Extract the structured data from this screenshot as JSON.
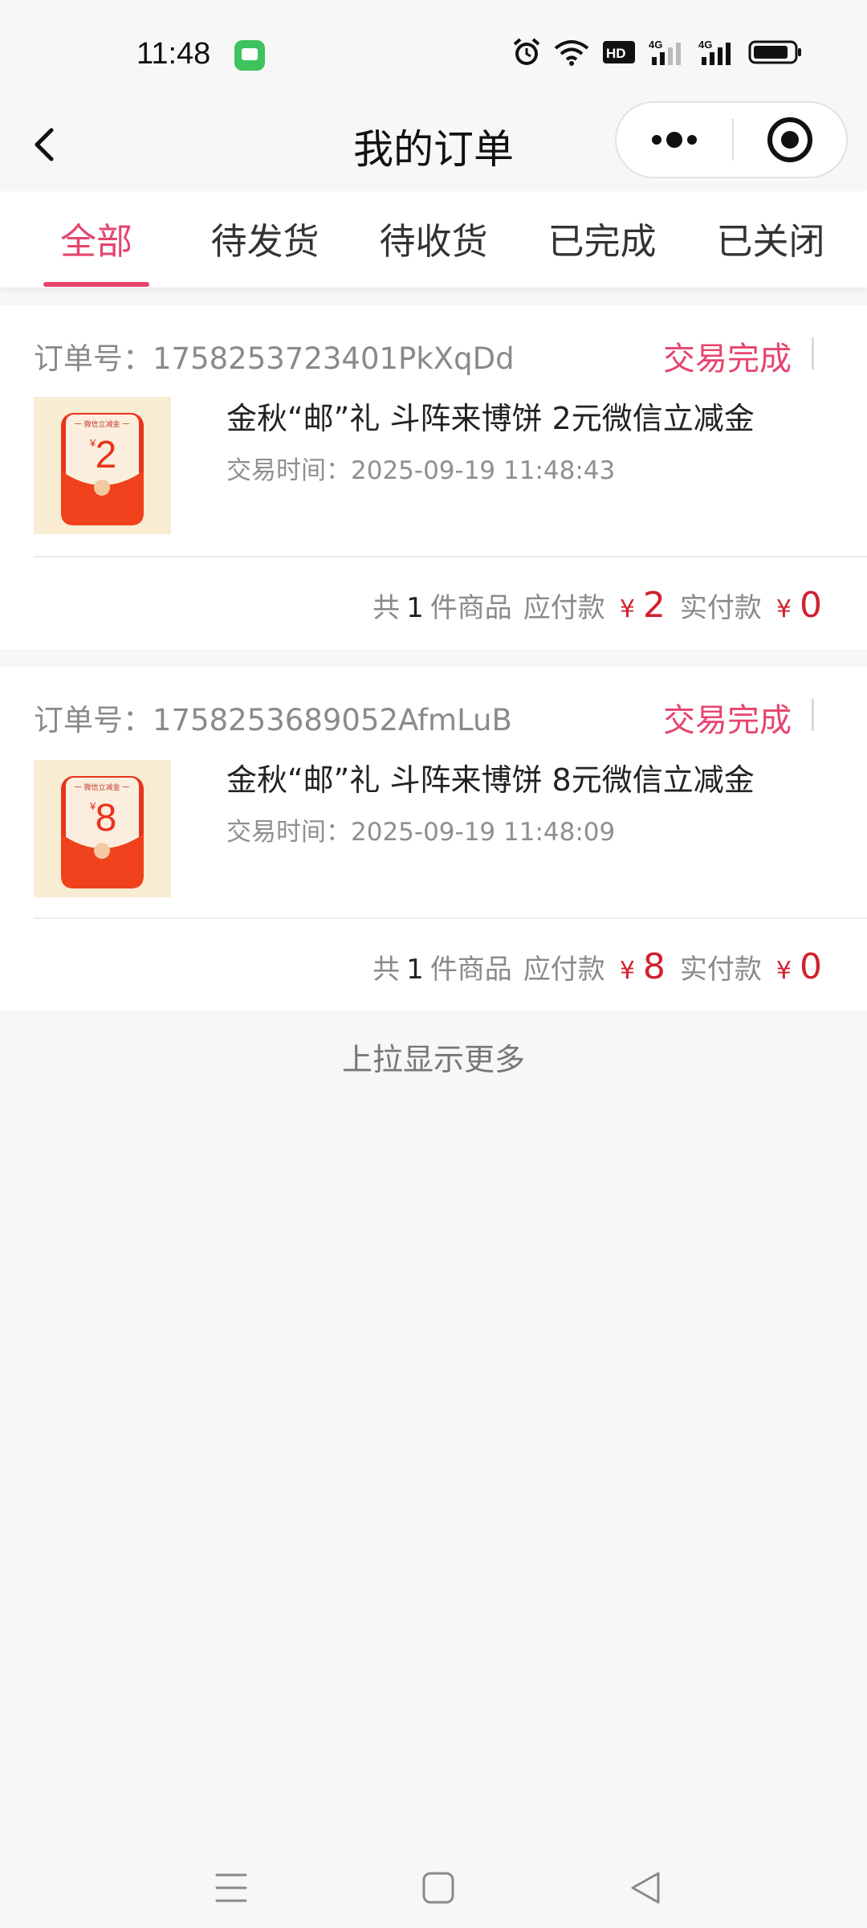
{
  "status_bar": {
    "time": "11:48",
    "icons": [
      "message-app-icon",
      "alarm-icon",
      "wifi-icon",
      "hd-icon",
      "signal-4g-icon",
      "signal-4g-icon",
      "battery-icon"
    ]
  },
  "nav": {
    "title": "我的订单",
    "back_icon": "back-arrow-icon",
    "more_icon": "more-dots-icon",
    "close_icon": "target-close-icon"
  },
  "tabs": [
    {
      "label": "全部",
      "active": true
    },
    {
      "label": "待发货",
      "active": false
    },
    {
      "label": "待收货",
      "active": false
    },
    {
      "label": "已完成",
      "active": false
    },
    {
      "label": "已关闭",
      "active": false
    }
  ],
  "orders": [
    {
      "order_no_label": "订单号：",
      "order_no": "1758253723401PkXqDd",
      "status": "交易完成",
      "thumb_header": "一 微信立减金 一",
      "thumb_value": "2",
      "title": "金秋“邮”礼 斗阵来博饼 2元微信立减金",
      "time_label": "交易时间：",
      "time": "2025-09-19 11:48:43",
      "count_prefix": "共",
      "count": "1",
      "count_suffix": "件商品",
      "payable_label": "应付款",
      "payable_currency": "¥",
      "payable": "2",
      "paid_label": "实付款",
      "paid_currency": "¥",
      "paid": "0"
    },
    {
      "order_no_label": "订单号：",
      "order_no": "1758253689052AfmLuB",
      "status": "交易完成",
      "thumb_header": "一 微信立减金 一",
      "thumb_value": "8",
      "title": "金秋“邮”礼 斗阵来博饼 8元微信立减金",
      "time_label": "交易时间：",
      "time": "2025-09-19 11:48:09",
      "count_prefix": "共",
      "count": "1",
      "count_suffix": "件商品",
      "payable_label": "应付款",
      "payable_currency": "¥",
      "payable": "8",
      "paid_label": "实付款",
      "paid_currency": "¥",
      "paid": "0"
    }
  ],
  "load_more": "上拉显示更多",
  "system_nav": [
    "menu-icon",
    "home-square-icon",
    "back-triangle-icon"
  ],
  "colors": {
    "accent": "#e6456d",
    "price": "#d0212f",
    "background": "#f7f7f7"
  }
}
